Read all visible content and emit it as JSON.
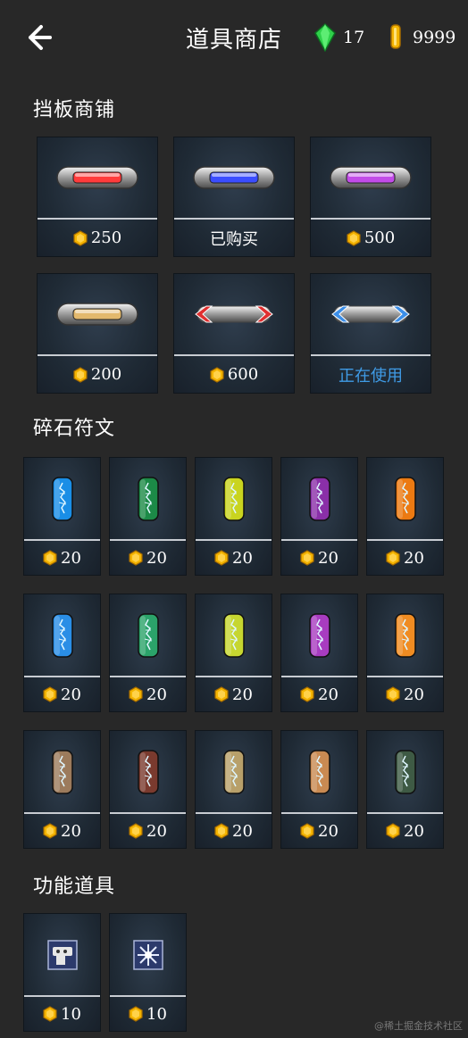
{
  "header": {
    "title": "道具商店",
    "gems": "17",
    "coins": "9999",
    "colors": {
      "gem": "#2fd14a",
      "coin": "#f4b400"
    }
  },
  "sections": {
    "boards": {
      "title": "挡板商铺",
      "items": [
        {
          "style": "red",
          "color": "#ff3b3b",
          "status": "price",
          "price": "250",
          "label": ""
        },
        {
          "style": "blue",
          "color": "#3b4dff",
          "status": "owned",
          "price": "",
          "label": "已购买"
        },
        {
          "style": "purple",
          "color": "#c24be8",
          "status": "price",
          "price": "500",
          "label": ""
        },
        {
          "style": "gold",
          "color": "#e3b96d",
          "status": "price",
          "price": "200",
          "label": ""
        },
        {
          "style": "red-arrows",
          "color": "#e03030",
          "status": "price",
          "price": "600",
          "label": ""
        },
        {
          "style": "blue-arrows",
          "color": "#3b8ee8",
          "status": "in-use",
          "price": "",
          "label": "正在使用"
        }
      ]
    },
    "runes": {
      "title": "碎石符文",
      "items": [
        {
          "color": "#1a8ee6",
          "price": "20"
        },
        {
          "color": "#1c8a47",
          "price": "20"
        },
        {
          "color": "#c9d41f",
          "price": "20"
        },
        {
          "color": "#8a2fa8",
          "price": "20"
        },
        {
          "color": "#ec7a12",
          "price": "20"
        },
        {
          "color": "#2a8ee6",
          "price": "20"
        },
        {
          "color": "#2ba36a",
          "price": "20"
        },
        {
          "color": "#c6d630",
          "price": "20"
        },
        {
          "color": "#a83cc0",
          "price": "20"
        },
        {
          "color": "#f08c22",
          "price": "20"
        },
        {
          "color": "#9c7b5c",
          "price": "20"
        },
        {
          "color": "#7a3a2e",
          "price": "20"
        },
        {
          "color": "#b8a06a",
          "price": "20"
        },
        {
          "color": "#c98a52",
          "price": "20"
        },
        {
          "color": "#3e5a44",
          "price": "20"
        }
      ]
    },
    "tools": {
      "title": "功能道具",
      "items": [
        {
          "icon": "pipe-block-icon",
          "price": "10"
        },
        {
          "icon": "burst-icon",
          "price": "10"
        }
      ]
    }
  },
  "watermark": "@稀土掘金技术社区"
}
